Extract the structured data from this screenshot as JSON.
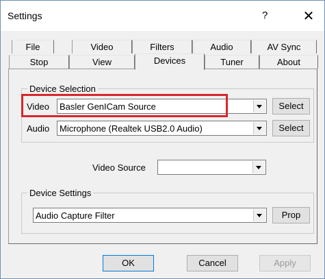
{
  "window": {
    "title": "Settings",
    "help_glyph": "?",
    "close_glyph": "✕"
  },
  "tabs": {
    "row1": [
      "File",
      "Video",
      "Filters",
      "Audio",
      "AV Sync"
    ],
    "row2": [
      "Stop",
      "View",
      "Devices",
      "Tuner",
      "About"
    ],
    "active": "Devices"
  },
  "device_selection": {
    "legend": "Device Selection",
    "video_label": "Video",
    "video_value": "Basler GenICam Source",
    "audio_label": "Audio",
    "audio_value": "Microphone (Realtek USB2.0 Audio)",
    "select_label": "Select"
  },
  "video_source": {
    "label": "Video Source",
    "value": ""
  },
  "device_settings": {
    "legend": "Device Settings",
    "value": "Audio Capture Filter",
    "prop_label": "Prop"
  },
  "footer": {
    "ok": "OK",
    "cancel": "Cancel",
    "apply": "Apply"
  },
  "colors": {
    "highlight": "#d8262d",
    "default_button_border": "#0078d7"
  }
}
